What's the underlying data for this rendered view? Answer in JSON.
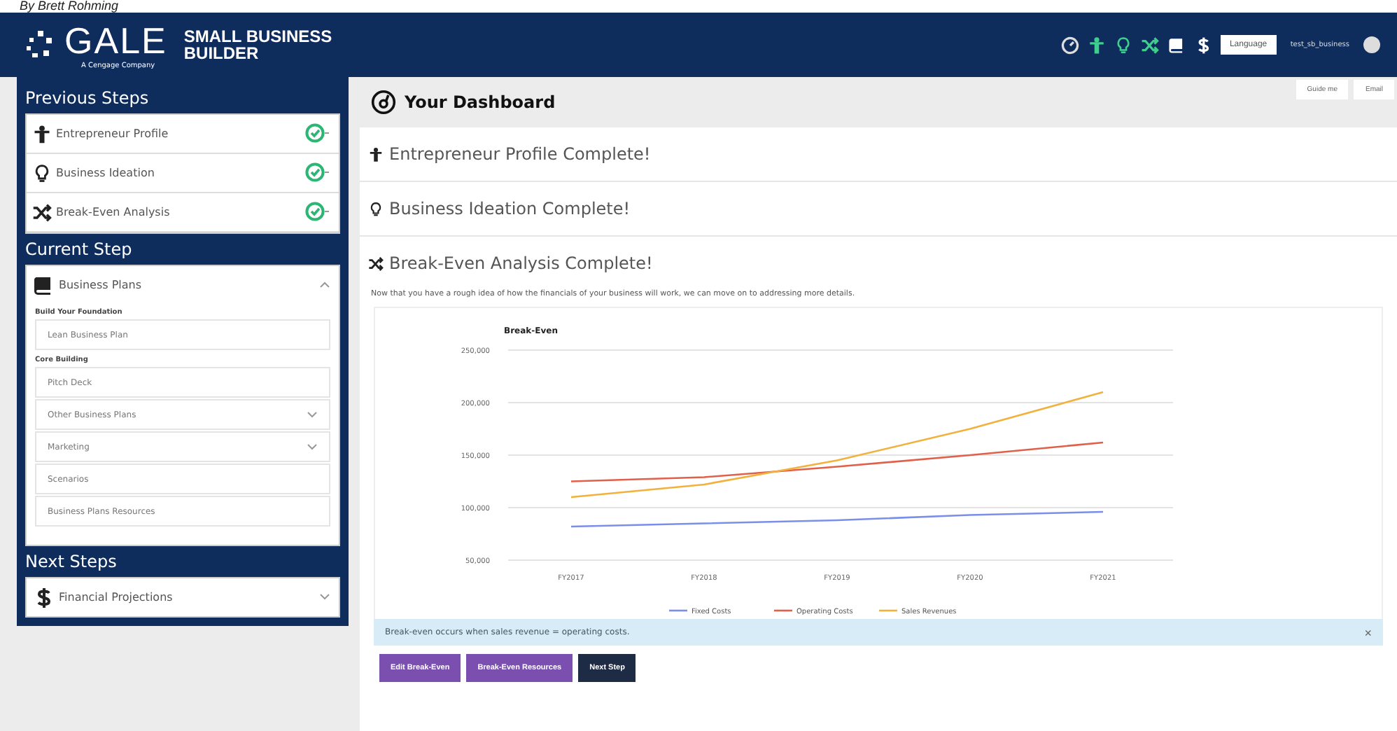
{
  "caption": "By Brett Rohming",
  "header": {
    "brand": "GALE",
    "tagline": "A Cengage Company",
    "product_line1": "SMALL BUSINESS",
    "product_line2": "BUILDER",
    "language_button": "Language",
    "username": "test_sb_business"
  },
  "sidebar": {
    "previous_title": "Previous Steps",
    "previous_items": [
      {
        "label": "Entrepreneur Profile",
        "complete": true
      },
      {
        "label": "Business Ideation",
        "complete": true
      },
      {
        "label": "Break-Even Analysis",
        "complete": true
      }
    ],
    "current_title": "Current Step",
    "current_item": {
      "label": "Business Plans",
      "expanded": true,
      "groups": [
        {
          "heading": "Build Your Foundation",
          "links": [
            {
              "label": "Lean Business Plan",
              "expandable": false
            }
          ]
        },
        {
          "heading": "Core Building",
          "links": [
            {
              "label": "Pitch Deck",
              "expandable": false
            },
            {
              "label": "Other Business Plans",
              "expandable": true
            },
            {
              "label": "Marketing",
              "expandable": true
            },
            {
              "label": "Scenarios",
              "expandable": false
            },
            {
              "label": "Business Plans Resources",
              "expandable": false
            }
          ]
        }
      ]
    },
    "next_title": "Next Steps",
    "next_items": [
      {
        "label": "Financial Projections",
        "expanded": false
      }
    ]
  },
  "toolbar": {
    "buttons": [
      "Guide me",
      "Email"
    ]
  },
  "dashboard": {
    "title": "Your Dashboard",
    "sections": [
      {
        "title": "Entrepreneur Profile Complete!"
      },
      {
        "title": "Business Ideation Complete!"
      },
      {
        "title": "Break-Even Analysis Complete!",
        "description": "Now that you have a rough idea of how the financials of your business will work, we can move on to addressing more details."
      }
    ],
    "chart_data": {
      "type": "line",
      "title": "Break-Even",
      "grid": true,
      "legend": true,
      "categories": [
        "FY2017",
        "FY2018",
        "FY2019",
        "FY2020",
        "FY2021"
      ],
      "ylim": [
        50000,
        250000
      ],
      "yticks": [
        {
          "value": 50000,
          "label": "50,000"
        },
        {
          "value": 100000,
          "label": "100,000"
        },
        {
          "value": 150000,
          "label": "150,000"
        },
        {
          "value": 200000,
          "label": "200,000"
        },
        {
          "value": 250000,
          "label": "250,000"
        }
      ],
      "series": [
        {
          "name": "Fixed Costs",
          "color": "#7b8ee8",
          "values": [
            82000,
            85000,
            88000,
            93000,
            96000
          ]
        },
        {
          "name": "Operating Costs",
          "color": "#e0604a",
          "values": [
            125000,
            129000,
            139000,
            150000,
            162000
          ]
        },
        {
          "name": "Sales Revenues",
          "color": "#f2b13c",
          "values": [
            110000,
            122000,
            145000,
            175000,
            210000
          ]
        }
      ]
    },
    "alert": {
      "text": "Break-even occurs when sales revenue = operating costs.",
      "close": "×"
    },
    "actions": [
      {
        "label": "Edit Break-Even",
        "kind": "secondary"
      },
      {
        "label": "Break-Even Resources",
        "kind": "secondary"
      },
      {
        "label": "Next Step",
        "kind": "primary"
      }
    ]
  }
}
